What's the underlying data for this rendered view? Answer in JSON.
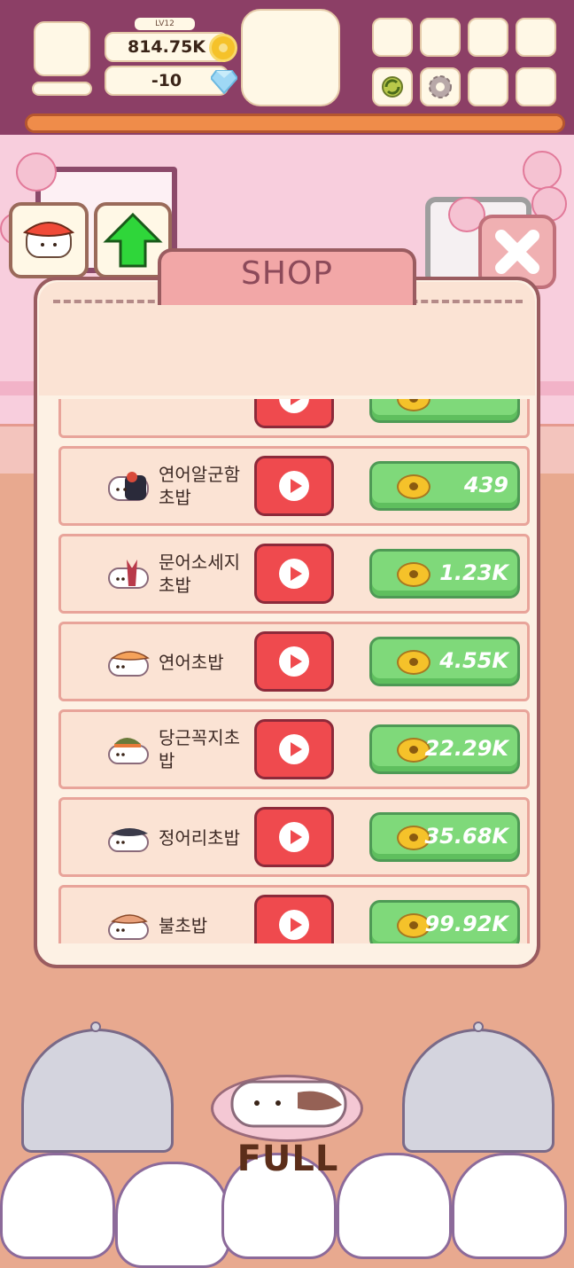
{
  "hud": {
    "level": "LV12",
    "coins": "814.75K",
    "gems": "-10"
  },
  "shop": {
    "title": "SHOP",
    "items": [
      {
        "name": "",
        "price": ""
      },
      {
        "name": "연어알군함\n초밥",
        "price": "439"
      },
      {
        "name": "문어소세지\n초밥",
        "price": "1.23K"
      },
      {
        "name": "연어초밥",
        "price": "4.55K"
      },
      {
        "name": "당근꼭지초\n밥",
        "price": "22.29K"
      },
      {
        "name": "정어리초밥",
        "price": "35.68K"
      },
      {
        "name": "불초밥",
        "price": "99.92K"
      }
    ]
  },
  "counter": {
    "status": "FULL"
  },
  "colors": {
    "hud_bg": "#8c3f66",
    "buy_green": "#7fd97a",
    "play_red": "#ef4a4e"
  }
}
